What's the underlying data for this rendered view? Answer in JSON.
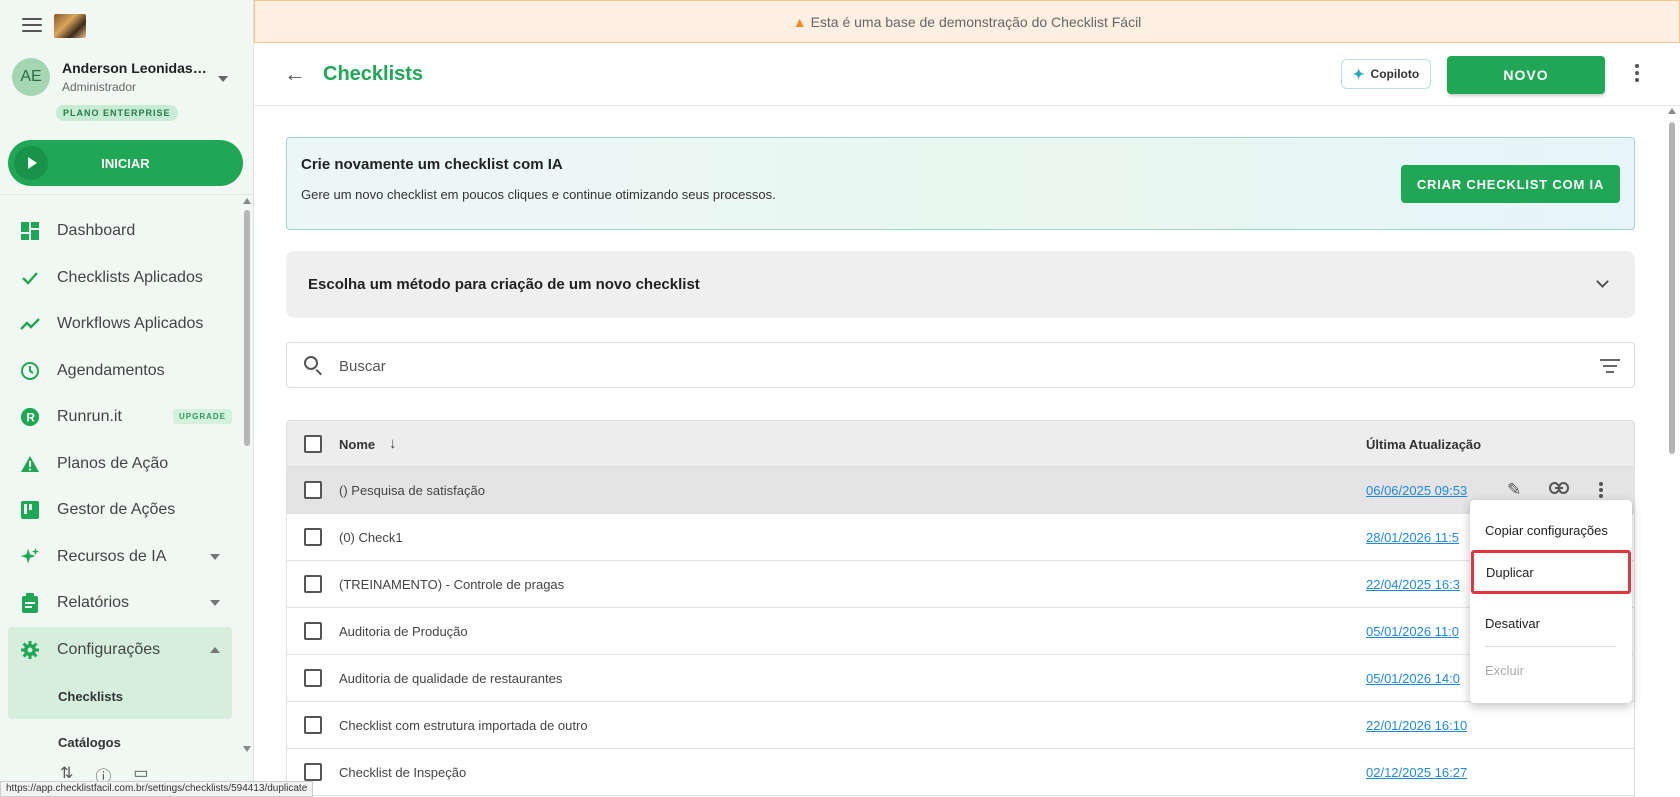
{
  "banner": {
    "text": "Esta é uma base de demonstração do Checklist Fácil"
  },
  "user": {
    "initials": "AE",
    "name": "Anderson Leonidas E...",
    "role": "Administrador",
    "plan": "PLANO ENTERPRISE"
  },
  "sidebar": {
    "start_label": "INICIAR",
    "items": [
      {
        "label": "Dashboard"
      },
      {
        "label": "Checklists Aplicados"
      },
      {
        "label": "Workflows Aplicados"
      },
      {
        "label": "Agendamentos"
      },
      {
        "label": "Runrun.it",
        "badge": "UPGRADE"
      },
      {
        "label": "Planos de Ação"
      },
      {
        "label": "Gestor de Ações"
      },
      {
        "label": "Recursos de IA"
      },
      {
        "label": "Relatórios"
      },
      {
        "label": "Configurações"
      }
    ],
    "sub_items": [
      {
        "label": "Checklists"
      },
      {
        "label": "Catálogos"
      }
    ]
  },
  "header": {
    "title": "Checklists",
    "copilot_label": "Copiloto",
    "new_label": "NOVO"
  },
  "ai_card": {
    "title": "Crie novamente um checklist com IA",
    "text": "Gere um novo checklist em poucos cliques e continue otimizando seus processos.",
    "button": "CRIAR CHECKLIST COM IA"
  },
  "method": {
    "label": "Escolha um método para criação de um novo checklist"
  },
  "search": {
    "placeholder": "Buscar",
    "value": ""
  },
  "table": {
    "col_name": "Nome",
    "col_date": "Última Atualização",
    "rows": [
      {
        "name": "() Pesquisa de satisfação",
        "date": "06/06/2025 09:53"
      },
      {
        "name": "(0) Check1",
        "date": "28/01/2026 11:5"
      },
      {
        "name": "(TREINAMENTO) - Controle de pragas",
        "date": "22/04/2025 16:3"
      },
      {
        "name": "Auditoria de Produção",
        "date": "05/01/2026 11:0"
      },
      {
        "name": "Auditoria de qualidade de restaurantes",
        "date": "05/01/2026 14:0"
      },
      {
        "name": "Checklist com estrutura importada de outro",
        "date": "22/01/2026 16:10"
      },
      {
        "name": "Checklist de Inspeção",
        "date": "02/12/2025 16:27"
      }
    ]
  },
  "context_menu": {
    "items": [
      {
        "label": "Copiar configurações"
      },
      {
        "label": "Duplicar"
      },
      {
        "label": "Desativar"
      },
      {
        "label": "Excluir"
      }
    ]
  },
  "statusbar": {
    "url": "https://app.checklistfacil.com.br/settings/checklists/594413/duplicate"
  },
  "colors": {
    "brand": "#1fa755",
    "link": "#1e88e5",
    "highlight": "#e0383e",
    "warning": "#f28c1e"
  },
  "icons": [
    "menu-icon",
    "play-icon",
    "dashboard-icon",
    "check-icon",
    "trending-icon",
    "clock-icon",
    "runrun-icon",
    "warning-icon",
    "kanban-icon",
    "sparkle-icon",
    "clipboard-icon",
    "gear-icon",
    "arrow-left-icon",
    "search-icon",
    "filter-icon",
    "pencil-icon",
    "link-icon",
    "more-vert-icon",
    "sort-down-icon",
    "chevron-down-icon",
    "upload-icon",
    "help-icon",
    "chat-icon"
  ]
}
